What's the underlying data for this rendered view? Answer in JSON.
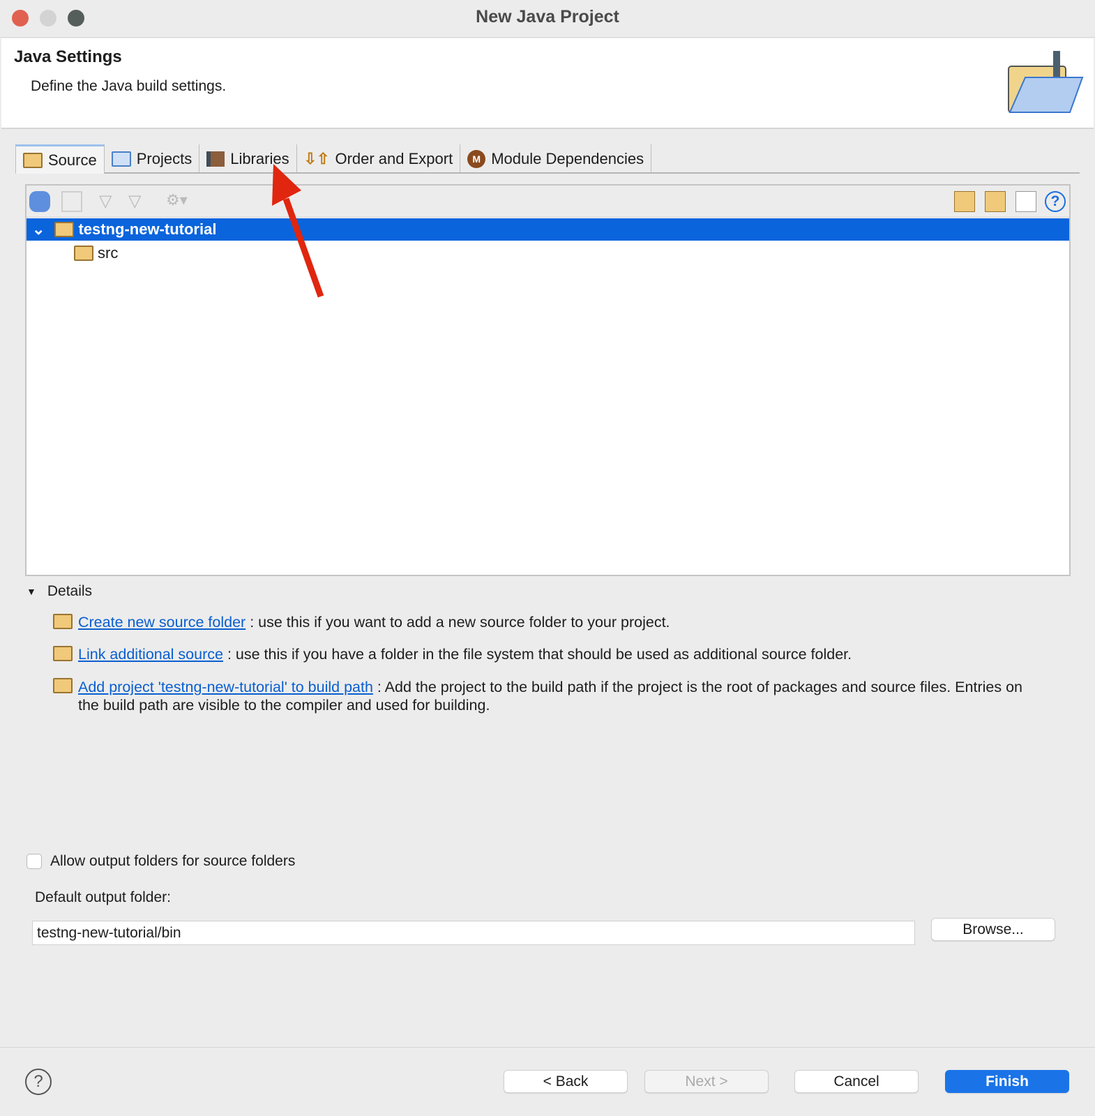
{
  "window": {
    "title": "New Java Project"
  },
  "header": {
    "title": "Java Settings",
    "description": "Define the Java build settings."
  },
  "tabs": [
    {
      "label": "Source",
      "active": true
    },
    {
      "label": "Projects"
    },
    {
      "label": "Libraries"
    },
    {
      "label": "Order and Export"
    },
    {
      "label": "Module Dependencies"
    }
  ],
  "tree": {
    "project": "testng-new-tutorial",
    "child": "src"
  },
  "details": {
    "label": "Details",
    "items": [
      {
        "link": "Create new source folder",
        "text": ": use this if you want to add a new source folder to your project."
      },
      {
        "link": "Link additional source",
        "text": ": use this if you have a folder in the file system that should be used as additional source folder."
      },
      {
        "link": "Add project 'testng-new-tutorial' to build path",
        "text": ": Add the project to the build path if the project is the root of packages and source files. Entries on the build path are visible to the compiler and used for building."
      }
    ]
  },
  "allow_output": {
    "label": "Allow output folders for source folders",
    "checked": false
  },
  "output": {
    "label": "Default output folder:",
    "value": "testng-new-tutorial/bin",
    "browse": "Browse..."
  },
  "buttons": {
    "back": "< Back",
    "next": "Next >",
    "cancel": "Cancel",
    "finish": "Finish"
  },
  "colors": {
    "selection": "#0a64dc",
    "finish": "#1a74e8",
    "annotation_arrow": "#e0260f"
  }
}
